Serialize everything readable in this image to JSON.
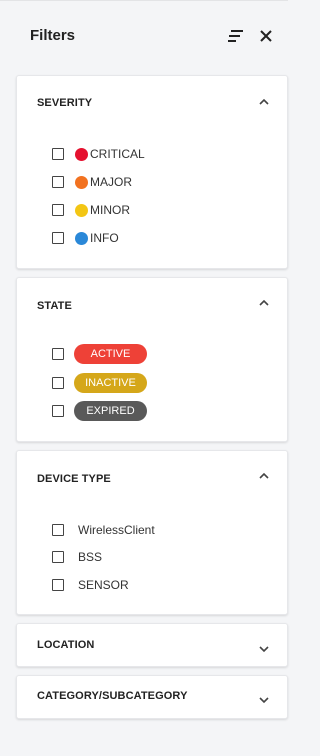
{
  "header": {
    "title": "Filters",
    "sort_icon": "sort-lines-icon",
    "close_icon": "close-icon"
  },
  "sections": {
    "severity": {
      "title": "SEVERITY",
      "expanded": true,
      "items": [
        {
          "label": "CRITICAL",
          "color": "#e5112f"
        },
        {
          "label": "MAJOR",
          "color": "#f27220"
        },
        {
          "label": "MINOR",
          "color": "#f3c614"
        },
        {
          "label": "INFO",
          "color": "#2a88d8"
        }
      ]
    },
    "state": {
      "title": "STATE",
      "expanded": true,
      "items": [
        {
          "label": "ACTIVE",
          "color": "#ee4137"
        },
        {
          "label": "INACTIVE",
          "color": "#d5a71a"
        },
        {
          "label": "EXPIRED",
          "color": "#595959"
        }
      ]
    },
    "device_type": {
      "title": "DEVICE TYPE",
      "expanded": true,
      "items": [
        {
          "label": "WirelessClient"
        },
        {
          "label": "BSS"
        },
        {
          "label": "SENSOR"
        }
      ]
    },
    "location": {
      "title": "LOCATION",
      "expanded": false
    },
    "category": {
      "title": "CATEGORY/SUBCATEGORY",
      "expanded": false
    }
  }
}
